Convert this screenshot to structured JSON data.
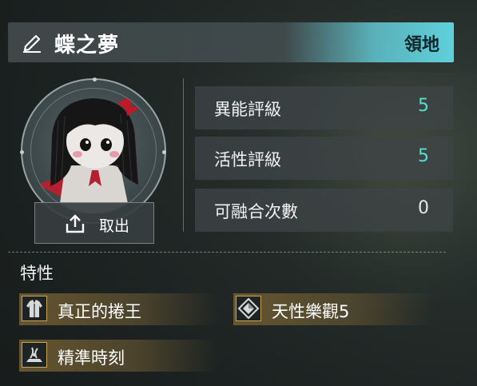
{
  "header": {
    "title": "蝶之夢",
    "territory_label": "領地",
    "accent_color": "#5fd0dc"
  },
  "avatar": {
    "retrieve_label": "取出"
  },
  "stats": [
    {
      "label": "異能評級",
      "value": "5",
      "color": "#52e0cf"
    },
    {
      "label": "活性評級",
      "value": "5",
      "color": "#52e0cf"
    },
    {
      "label": "可融合次數",
      "value": "0",
      "color": "#e6e6e6"
    }
  ],
  "traits": {
    "heading": "特性",
    "items": [
      {
        "label": "真正的捲王",
        "icon": "coat-icon"
      },
      {
        "label": "天性樂觀5",
        "icon": "diamond-icon"
      },
      {
        "label": "精準時刻",
        "icon": "hourglass-icon"
      }
    ]
  }
}
